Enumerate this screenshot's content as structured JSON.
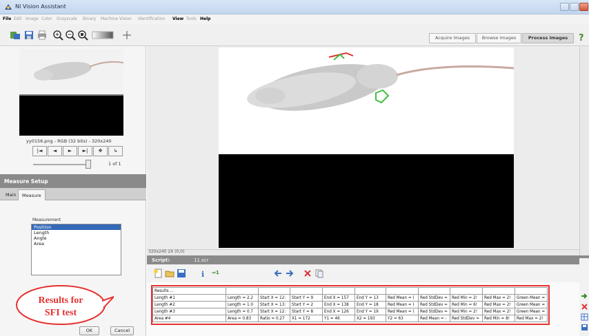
{
  "window": {
    "title": "NI Vision Assistant"
  },
  "menu": [
    {
      "label": "File",
      "enabled": true
    },
    {
      "label": "Edit",
      "enabled": false
    },
    {
      "label": "Image",
      "enabled": false
    },
    {
      "label": "Color",
      "enabled": false
    },
    {
      "label": "Grayscale",
      "enabled": false
    },
    {
      "label": "Binary",
      "enabled": false
    },
    {
      "label": "Machine Vision",
      "enabled": false
    },
    {
      "label": "Identification",
      "enabled": false
    },
    {
      "label": "View",
      "enabled": true
    },
    {
      "label": "Tools",
      "enabled": false
    },
    {
      "label": "Help",
      "enabled": true
    }
  ],
  "toolbar": {
    "modes": [
      "Acquire Images",
      "Browse Images",
      "Process Images"
    ],
    "active_mode": "Process Images",
    "icons": [
      "acquire-icon",
      "save-icon",
      "print-icon",
      "zoom-in-icon",
      "zoom-out-icon",
      "zoom-fit-icon",
      "color-palette-icon",
      "cursor-icon",
      "help-icon"
    ]
  },
  "browser": {
    "image_info": "yy0156.png - RGB (32 bits) - 320x240",
    "nav_buttons": [
      "|◄",
      "◄",
      "►",
      "►|",
      "✥",
      "↳"
    ],
    "page_indicator": "1 of 1"
  },
  "measure_setup": {
    "title": "Measure Setup",
    "tabs": [
      "Main",
      "Measure"
    ],
    "active_tab": "Measure",
    "measurement_label": "Measurement",
    "options": [
      "Position",
      "Length",
      "Angle",
      "Area"
    ],
    "selected_option": "Position",
    "ok_label": "OK",
    "cancel_label": "Cancel"
  },
  "image_view": {
    "status": "320x240 2X  (0,0)"
  },
  "script": {
    "label": "Script:",
    "filename": "11.scr",
    "step_label": "⇒1"
  },
  "results": {
    "header": "Results ...",
    "rows": [
      [
        "Length #1",
        "Length = 2.2",
        "Start X = 12:",
        "Start Y = 9",
        "End X = 157",
        "End Y = 13",
        "Red Mean = (",
        "Red StdDev =",
        "Red Min = 2!",
        "Red Max = 2!",
        "Green Mean ="
      ],
      [
        "Length #2",
        "Length = 1.0",
        "Start X = 13:",
        "Start Y = 2",
        "End X = 138",
        "End Y = 18",
        "Red Mean = (",
        "Red StdDev =",
        "Red Min = 6!",
        "Red Max = 2!",
        "Green Mean ="
      ],
      [
        "Length #3",
        "Length = 0.7",
        "Start X = 12:",
        "Start Y = 8",
        "End X = 126",
        "End Y = 19",
        "Red Mean = (",
        "Red StdDev =",
        "Red Min = 2!",
        "Red Max = 2!",
        "Green Mean ="
      ],
      [
        "Area #4",
        "Area = 0.83",
        "Ratio = 0.27",
        "X1 = 172",
        "Y1 = 46",
        "X2 = 193",
        "Y2 = 63",
        "Red Mean = :",
        "Red StdDev =",
        "Red Min = 8!",
        "Red Max = 2!"
      ]
    ]
  },
  "annotation": {
    "line1": "Results  for",
    "line2": "SFI test"
  },
  "colors": {
    "annotation_red": "#e53030",
    "selection_blue": "#3469b8",
    "header_gray": "#8a8a8a"
  }
}
